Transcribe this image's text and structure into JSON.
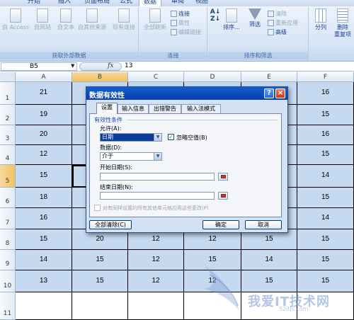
{
  "ribbon": {
    "tabs": [
      {
        "label": "开始",
        "active": false
      },
      {
        "label": "插入",
        "active": false
      },
      {
        "label": "页面布局",
        "active": false
      },
      {
        "label": "公式",
        "active": false
      },
      {
        "label": "数据",
        "active": true
      },
      {
        "label": "审阅",
        "active": false
      },
      {
        "label": "视图",
        "active": false
      }
    ],
    "groups": {
      "external": {
        "label": "获取外部数据",
        "buttons": [
          "自 Access",
          "自网站",
          "自文本",
          "自其他来源",
          "现有连接"
        ]
      },
      "connections": {
        "label": "连接",
        "refresh": "全部刷新",
        "links": "连接",
        "properties": "属性",
        "edit_links": "编辑链接"
      },
      "sort_filter": {
        "label": "排序和筛选",
        "sort": "排序...",
        "filter": "筛选",
        "clear": "清除",
        "reapply": "重新应用",
        "advanced": "高级"
      },
      "tools": {
        "split": "分列",
        "remove_dup_line1": "删除",
        "remove_dup_line2": "重复项"
      }
    }
  },
  "formula_bar": {
    "name_box": "B5",
    "fx": "fx",
    "value": "13"
  },
  "sheet": {
    "columns": [
      "A",
      "B",
      "C",
      "D",
      "E",
      "F"
    ],
    "rows": [
      {
        "num": "1",
        "cells": [
          "21",
          "",
          "",
          "",
          "",
          "16"
        ]
      },
      {
        "num": "2",
        "cells": [
          "19",
          "",
          "",
          "",
          "",
          "15"
        ]
      },
      {
        "num": "3",
        "cells": [
          "20",
          "",
          "",
          "",
          "",
          "16"
        ]
      },
      {
        "num": "4",
        "cells": [
          "12",
          "",
          "",
          "",
          "",
          "15"
        ]
      },
      {
        "num": "5",
        "cells": [
          "15",
          "",
          "",
          "",
          "",
          "14"
        ]
      },
      {
        "num": "6",
        "cells": [
          "18",
          "",
          "",
          "",
          "",
          "15"
        ]
      },
      {
        "num": "7",
        "cells": [
          "16",
          "",
          "",
          "",
          "",
          "14"
        ]
      },
      {
        "num": "8",
        "cells": [
          "15",
          "20",
          "12",
          "12",
          "15",
          "15"
        ]
      },
      {
        "num": "9",
        "cells": [
          "14",
          "15",
          "12",
          "15",
          "14",
          "15"
        ]
      },
      {
        "num": "10",
        "cells": [
          "13",
          "15",
          "12",
          "12",
          "15",
          "15"
        ]
      },
      {
        "num": "11",
        "cells": [
          "",
          "",
          "",
          "",
          "",
          ""
        ]
      }
    ]
  },
  "dialog": {
    "title": "数据有效性",
    "help": "?",
    "close": "×",
    "tabs": [
      "设置",
      "输入信息",
      "出错警告",
      "输入法模式"
    ],
    "section": "有效性条件",
    "allow_label": "允许(A):",
    "allow_value": "日期",
    "ignore_blank": "忽略空值(B)",
    "data_label": "数据(D):",
    "data_value": "介于",
    "start_label": "开始日期(S):",
    "end_label": "结束日期(N):",
    "apply_all": "对有同样设置的所有其他单元格应用这些更改(P)",
    "clear_all": "全部清除(C)",
    "ok": "确定",
    "cancel": "取消"
  },
  "watermark": {
    "text": "我爱IT技术网",
    "url": "52itjs.com"
  },
  "colors": {
    "cell_fill": "#c5d9f1",
    "title_bar": "#0a3ea8",
    "ribbon_bg": "#d6e4f5"
  }
}
